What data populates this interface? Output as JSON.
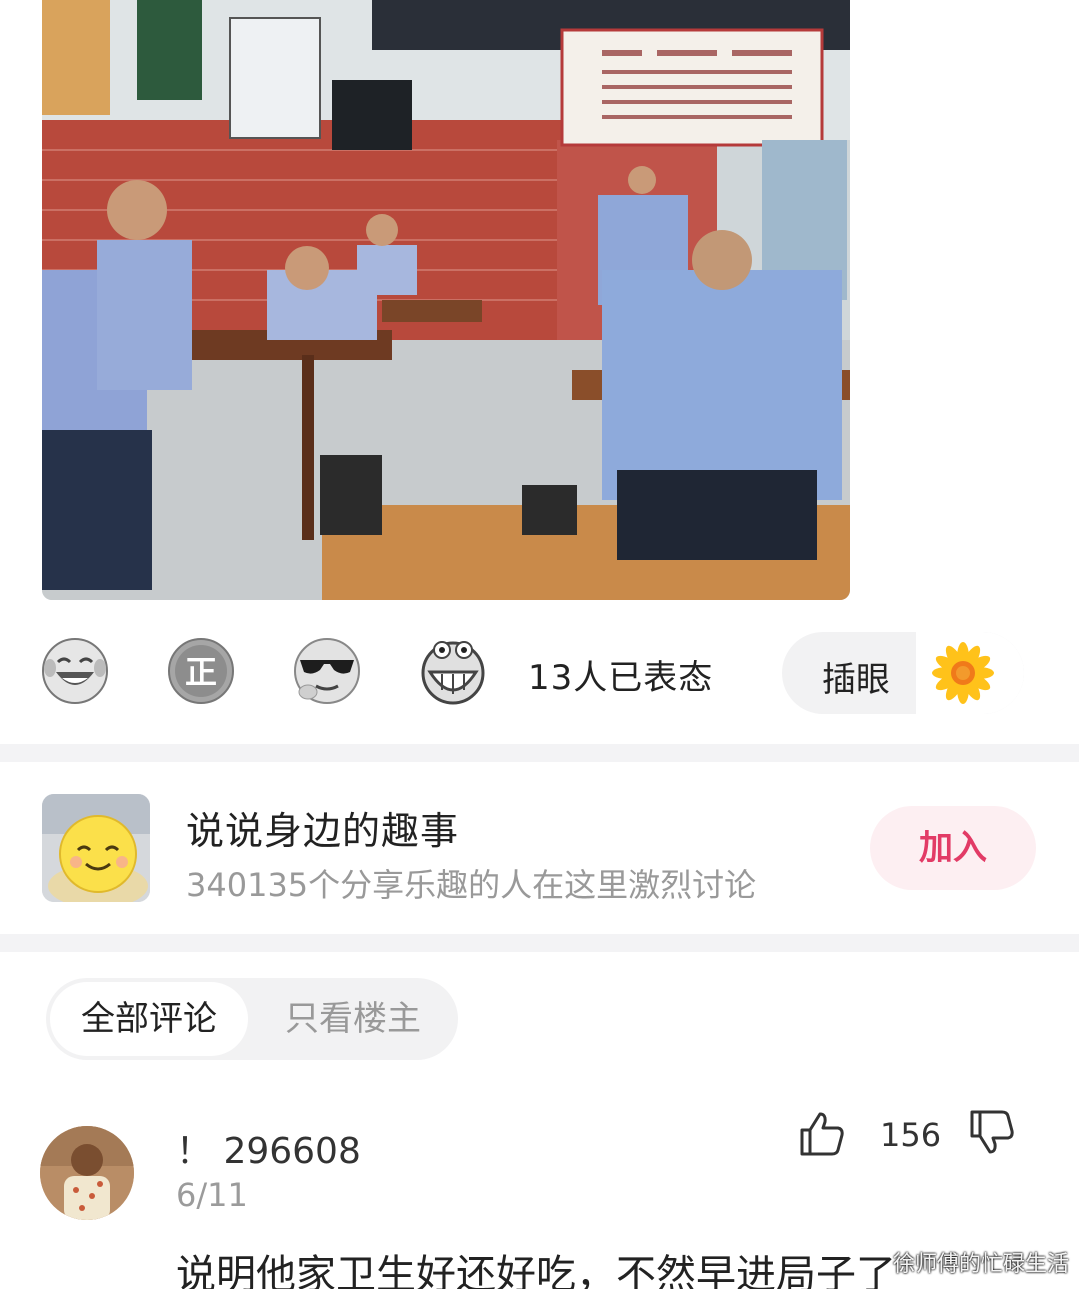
{
  "post": {
    "photo": {
      "icon": "restaurant-photo"
    }
  },
  "reactions": {
    "emojis": [
      "laughing-tears-emoji-icon",
      "zheng-emoji-icon",
      "sunglasses-emoji-icon",
      "grinning-emoji-icon"
    ],
    "count_text": "13人已表态",
    "pill_label": "插眼",
    "pill_icon": "sunflower-icon"
  },
  "group": {
    "title": "说说身边的趣事",
    "subtitle": "340135个分享乐趣的人在这里激烈讨论",
    "join_label": "加入",
    "join_color": "#e23b66"
  },
  "comment_tabs": {
    "all": "全部评论",
    "op_only": "只看楼主"
  },
  "comment": {
    "username": "！ 296608",
    "date": "6/11",
    "like_count": "156",
    "text": "说明他家卫生好还好吃，不然早进局子了"
  },
  "watermark": "徐师傅的忙碌生活"
}
